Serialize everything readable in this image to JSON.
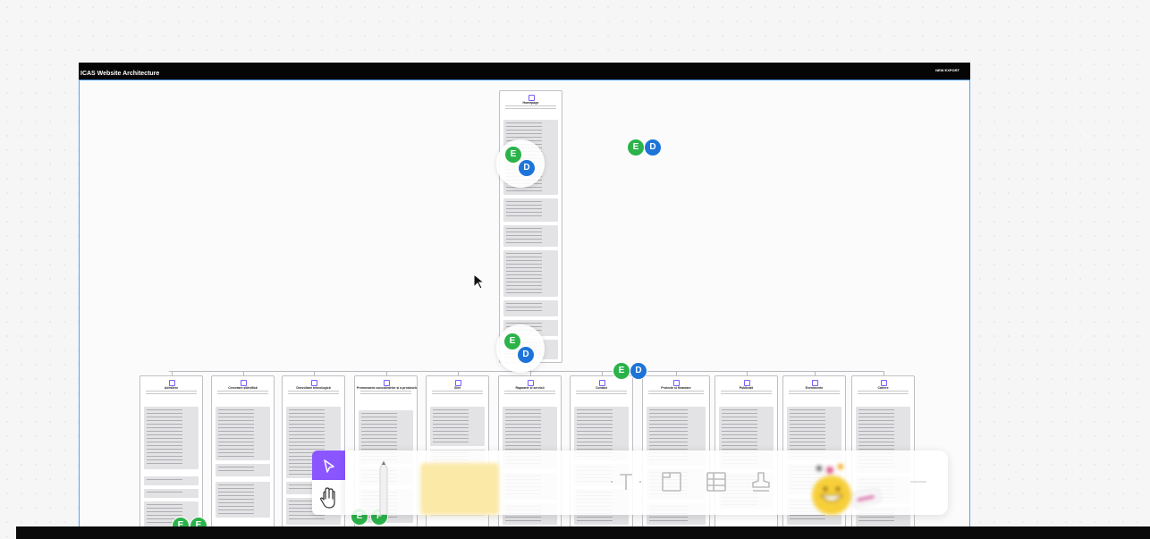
{
  "board": {
    "title": "ICAS Website Architecture",
    "header_right_title": "NEW EXPORT",
    "frame_color": "#4da3ff"
  },
  "pages": {
    "home": {
      "title": "Homepage"
    },
    "children": [
      {
        "title": "Admitere"
      },
      {
        "title": "Cercetare științifică"
      },
      {
        "title": "Dezvoltare tehnologică"
      },
      {
        "title": "Promovarea cunoștințelor și a produselor"
      },
      {
        "title": "Știri"
      },
      {
        "title": "Rapoarte și servicii"
      },
      {
        "title": "Contact"
      },
      {
        "title": "Proiecte și finanțare"
      },
      {
        "title": "Publicații"
      },
      {
        "title": "Evenimente"
      },
      {
        "title": "Cariere"
      }
    ]
  },
  "collaborators": [
    {
      "initial": "E",
      "color": "#2bb34a"
    },
    {
      "initial": "D",
      "color": "#1d74d8"
    },
    {
      "initial": "F",
      "color": "#2bb34a"
    }
  ],
  "toolbar": {
    "tools": [
      {
        "name": "select",
        "icon": "pointer-icon"
      },
      {
        "name": "hand",
        "icon": "hand-icon"
      },
      {
        "name": "pen",
        "icon": "pen-icon"
      },
      {
        "name": "sticky-note",
        "icon": "sticky-note-icon"
      },
      {
        "name": "text",
        "icon": "text-icon"
      },
      {
        "name": "frame",
        "icon": "frame-icon"
      },
      {
        "name": "table",
        "icon": "table-icon"
      },
      {
        "name": "stamp",
        "icon": "stamp-icon"
      },
      {
        "name": "stickers",
        "icon": "sticker-icon"
      }
    ],
    "accent": "#8b56ff"
  }
}
